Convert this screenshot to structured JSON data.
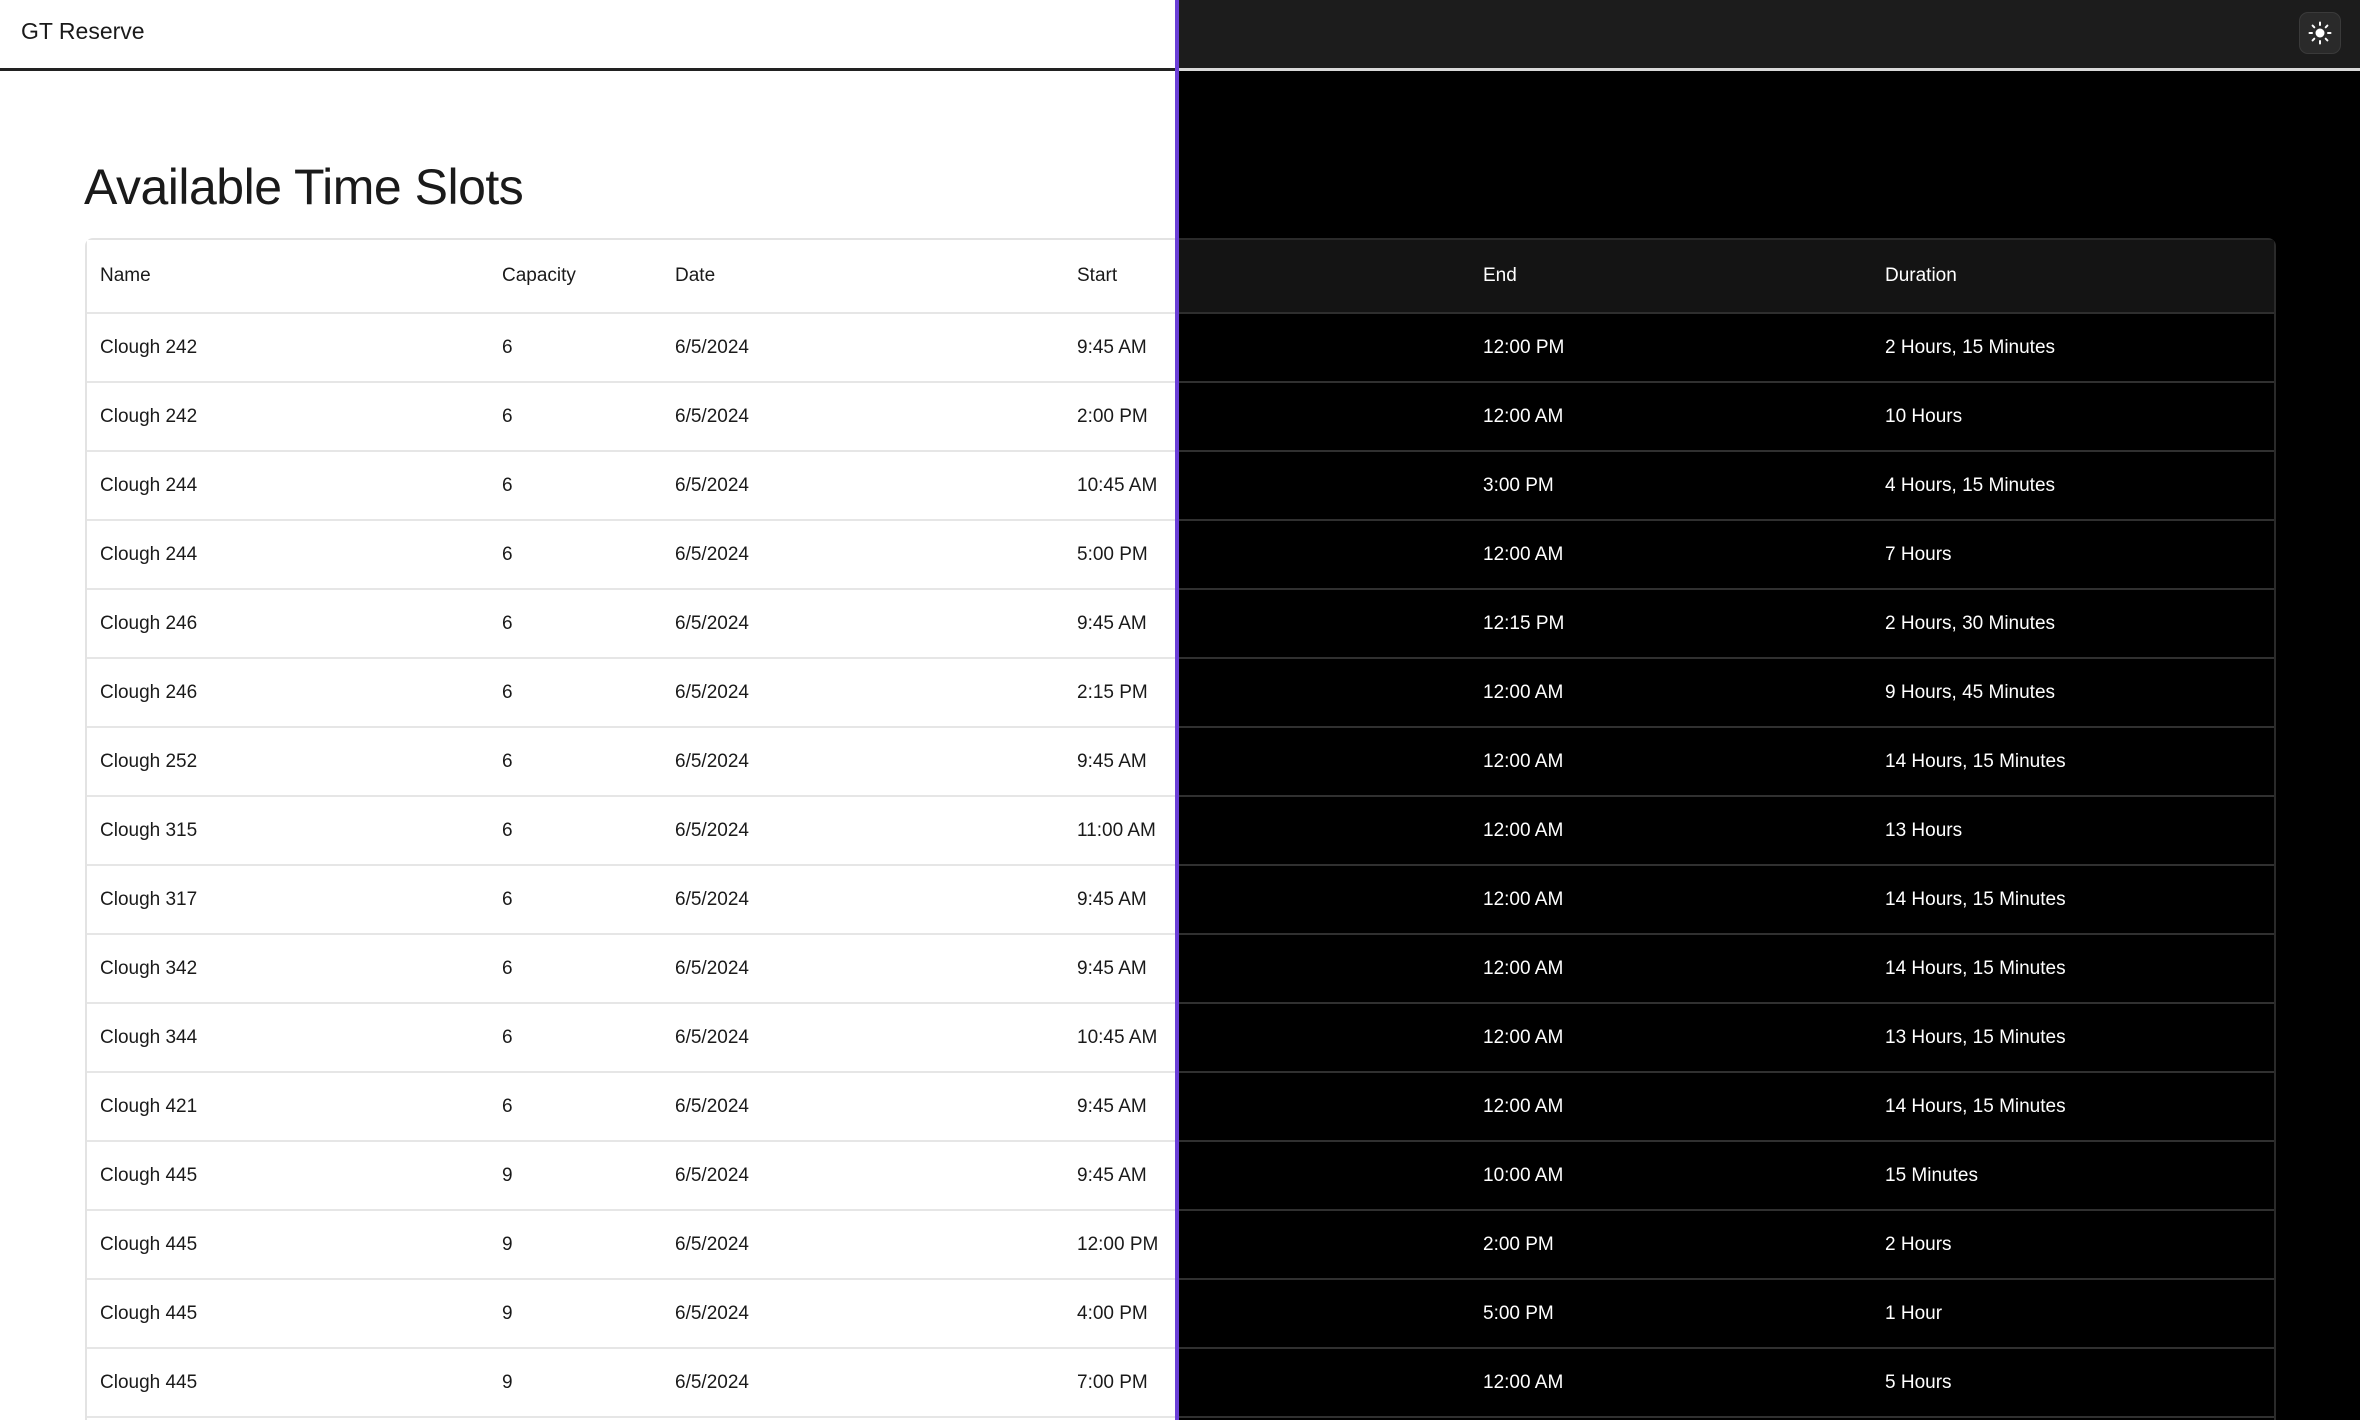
{
  "app": {
    "title": "GT Reserve"
  },
  "theme_toggle": {
    "icon": "sun-icon"
  },
  "page": {
    "title": "Available Time Slots"
  },
  "table": {
    "columns": [
      "Name",
      "Capacity",
      "Date",
      "Start",
      "End",
      "Duration"
    ],
    "rows": [
      [
        "Clough 242",
        "6",
        "6/5/2024",
        "9:45 AM",
        "12:00 PM",
        "2 Hours, 15 Minutes"
      ],
      [
        "Clough 242",
        "6",
        "6/5/2024",
        "2:00 PM",
        "12:00 AM",
        "10 Hours"
      ],
      [
        "Clough 244",
        "6",
        "6/5/2024",
        "10:45 AM",
        "3:00 PM",
        "4 Hours, 15 Minutes"
      ],
      [
        "Clough 244",
        "6",
        "6/5/2024",
        "5:00 PM",
        "12:00 AM",
        "7 Hours"
      ],
      [
        "Clough 246",
        "6",
        "6/5/2024",
        "9:45 AM",
        "12:15 PM",
        "2 Hours, 30 Minutes"
      ],
      [
        "Clough 246",
        "6",
        "6/5/2024",
        "2:15 PM",
        "12:00 AM",
        "9 Hours, 45 Minutes"
      ],
      [
        "Clough 252",
        "6",
        "6/5/2024",
        "9:45 AM",
        "12:00 AM",
        "14 Hours, 15 Minutes"
      ],
      [
        "Clough 315",
        "6",
        "6/5/2024",
        "11:00 AM",
        "12:00 AM",
        "13 Hours"
      ],
      [
        "Clough 317",
        "6",
        "6/5/2024",
        "9:45 AM",
        "12:00 AM",
        "14 Hours, 15 Minutes"
      ],
      [
        "Clough 342",
        "6",
        "6/5/2024",
        "9:45 AM",
        "12:00 AM",
        "14 Hours, 15 Minutes"
      ],
      [
        "Clough 344",
        "6",
        "6/5/2024",
        "10:45 AM",
        "12:00 AM",
        "13 Hours, 15 Minutes"
      ],
      [
        "Clough 421",
        "6",
        "6/5/2024",
        "9:45 AM",
        "12:00 AM",
        "14 Hours, 15 Minutes"
      ],
      [
        "Clough 445",
        "9",
        "6/5/2024",
        "9:45 AM",
        "10:00 AM",
        "15 Minutes"
      ],
      [
        "Clough 445",
        "9",
        "6/5/2024",
        "12:00 PM",
        "2:00 PM",
        "2 Hours"
      ],
      [
        "Clough 445",
        "9",
        "6/5/2024",
        "4:00 PM",
        "5:00 PM",
        "1 Hour"
      ],
      [
        "Clough 445",
        "9",
        "6/5/2024",
        "7:00 PM",
        "12:00 AM",
        "5 Hours"
      ]
    ]
  },
  "colors": {
    "light_bg": "#ffffff",
    "dark_bg": "#000000",
    "divider": "#6a3fd6"
  }
}
